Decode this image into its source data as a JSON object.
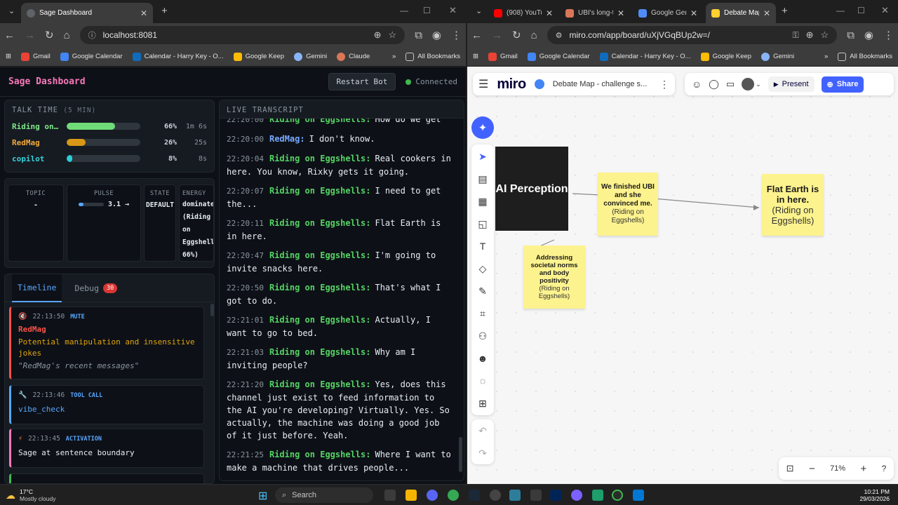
{
  "left_window": {
    "tab": {
      "title": "Sage Dashboard"
    },
    "url": "localhost:8081",
    "bookmarks": [
      "Gmail",
      "Google Calendar",
      "Calendar - Harry Key - O...",
      "Google Keep",
      "Gemini",
      "Claude"
    ],
    "all_bookmarks": "All Bookmarks",
    "more": "»"
  },
  "sage": {
    "title": "Sage Dashboard",
    "restart_label": "Restart Bot",
    "status": "Connected",
    "talk_time": {
      "title": "TALK TIME",
      "window": "(5 MIN)",
      "rows": [
        {
          "name": "Riding on…",
          "pct": "66%",
          "fraction": 0.66,
          "duration": "1m 6s",
          "color": "#7ee787",
          "bar": "#6fdc78"
        },
        {
          "name": "RedMag",
          "pct": "26%",
          "fraction": 0.26,
          "duration": "25s",
          "color": "#f0a83b",
          "bar": "#d99716"
        },
        {
          "name": "copilot",
          "pct": "8%",
          "fraction": 0.08,
          "duration": "8s",
          "color": "#39d0d8",
          "bar": "#2ccfd6"
        }
      ]
    },
    "stats": {
      "topic_label": "TOPIC",
      "topic_value": "-",
      "pulse_label": "PULSE",
      "pulse_value": "3.1 →",
      "pulse_fraction": 0.2,
      "state_label": "STATE",
      "state_value": "DEFAULT",
      "energy_label": "ENERGY",
      "energy_value": "dominated (Riding on Eggshells 66%)"
    },
    "tabs": {
      "timeline": "Timeline",
      "debug": "Debug",
      "debug_count": "30"
    },
    "timeline": [
      {
        "icon": "🔇",
        "time": "22:13:50",
        "type": "MUTE",
        "type_color": "#58a6ff",
        "border": "#f85149",
        "name": "RedMag",
        "reason": "Potential manipulation and insensitive jokes",
        "quote": "\"RedMag's recent messages\""
      },
      {
        "icon": "🔧",
        "time": "22:13:46",
        "type": "TOOL CALL",
        "type_color": "#58a6ff",
        "border": "#58a6ff",
        "detail": "vibe_check"
      },
      {
        "icon": "⚡",
        "time": "22:13:45",
        "type": "ACTIVATION",
        "type_color": "#58a6ff",
        "border": "#f778ba",
        "detail": "Sage at sentence boundary"
      }
    ],
    "transcript": {
      "title": "LIVE TRANSCRIPT",
      "lines": [
        {
          "time": "22:20:00",
          "speaker": "Riding on Eggshells:",
          "color": "#56d364",
          "text": "How do we get"
        },
        {
          "time": "22:20:00",
          "speaker": "RedMag:",
          "color": "#79a8ff",
          "text": "I don't know."
        },
        {
          "time": "22:20:04",
          "speaker": "Riding on Eggshells:",
          "color": "#56d364",
          "text": "Real cookers in here. You know, Rixky gets it going."
        },
        {
          "time": "22:20:07",
          "speaker": "Riding on Eggshells:",
          "color": "#56d364",
          "text": "I need to get the..."
        },
        {
          "time": "22:20:11",
          "speaker": "Riding on Eggshells:",
          "color": "#56d364",
          "text": "Flat Earth is in here."
        },
        {
          "time": "22:20:47",
          "speaker": "Riding on Eggshells:",
          "color": "#56d364",
          "text": "I'm going to invite snacks here."
        },
        {
          "time": "22:20:50",
          "speaker": "Riding on Eggshells:",
          "color": "#56d364",
          "text": "That's what I got to do."
        },
        {
          "time": "22:21:01",
          "speaker": "Riding on Eggshells:",
          "color": "#56d364",
          "text": "Actually, I want to go to bed."
        },
        {
          "time": "22:21:03",
          "speaker": "Riding on Eggshells:",
          "color": "#56d364",
          "text": "Why am I inviting people?"
        },
        {
          "time": "22:21:20",
          "speaker": "Riding on Eggshells:",
          "color": "#56d364",
          "text": "Yes, does this channel just exist to feed information to the AI you're developing? Virtually. Yes. So actually, the machine was doing a good job of it just before. Yeah."
        },
        {
          "time": "22:21:25",
          "speaker": "Riding on Eggshells:",
          "color": "#56d364",
          "text": "Where I want to make a machine that drives people..."
        }
      ]
    }
  },
  "right_window": {
    "tabs": [
      {
        "title": "(908) YouTub",
        "color": "#ff0000"
      },
      {
        "title": "UBI's long-te",
        "color": "#d97757"
      },
      {
        "title": "Google Gemi",
        "color": "#4f8cf7"
      },
      {
        "title": "Debate Map",
        "color": "#ffd02f"
      }
    ],
    "url": "miro.com/app/board/uXjVGqBUp2w=/",
    "bookmarks": [
      "Gmail",
      "Google Calendar",
      "Calendar - Harry Key - O...",
      "Google Keep",
      "Gemini"
    ],
    "all_bookmarks": "All Bookmarks",
    "more": "»"
  },
  "miro": {
    "logo": "miro",
    "board_name": "Debate Map - challenge s...",
    "present": "Present",
    "share": "Share",
    "zoom": "71%",
    "ai_card": "AI Perception",
    "notes": [
      {
        "title": "We finished UBI and she convinced me.",
        "sub": "(Riding on Eggshells)"
      },
      {
        "title": "Flat Earth is in here.",
        "sub": "(Riding on Eggshells)"
      },
      {
        "title": "Addressing societal norms and body positivity",
        "sub": "(Riding on Eggshells)"
      }
    ]
  },
  "taskbar": {
    "temp": "17°C",
    "weather": "Mostly cloudy",
    "search": "Search",
    "time": "10:21 PM",
    "date": "29/03/2026"
  }
}
